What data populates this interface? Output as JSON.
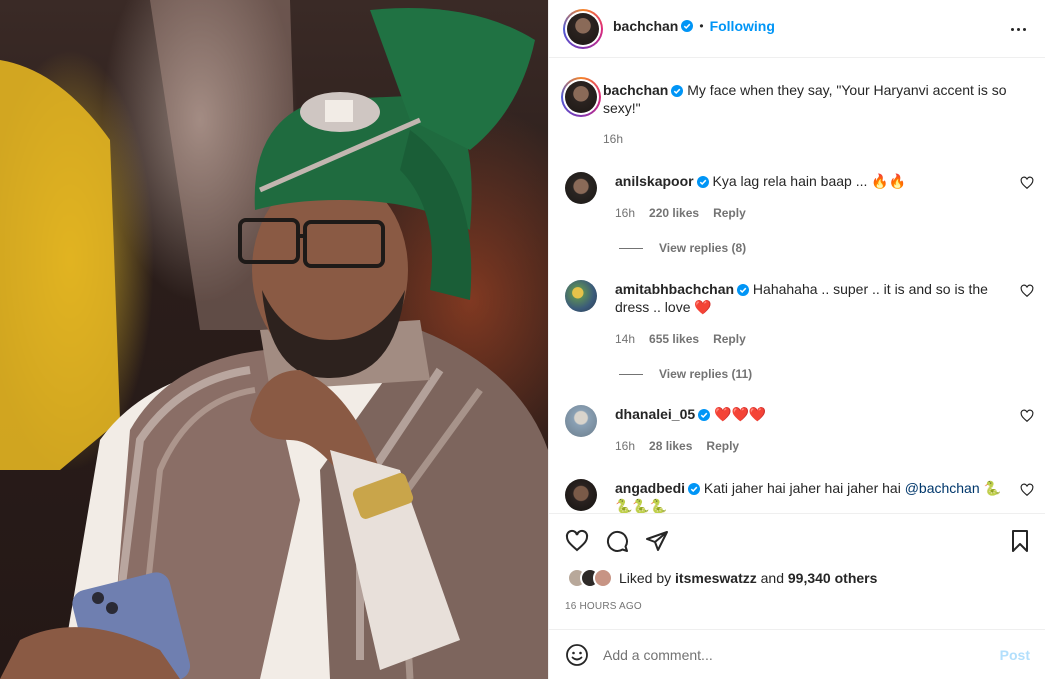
{
  "post": {
    "author": "bachchan",
    "follow_status": "Following",
    "dot": "•",
    "caption": "My face when they say, \"Your Haryanvi accent is so sexy!\"",
    "caption_time": "16h"
  },
  "comments": [
    {
      "user": "anilskapoor",
      "text": "Kya lag rela hain baap ... 🔥🔥",
      "time": "16h",
      "likes": "220 likes",
      "reply": "Reply",
      "view_replies": "View replies (8)"
    },
    {
      "user": "amitabhbachchan",
      "text": "Hahahaha .. super .. it is and so is the dress .. love ❤️",
      "time": "14h",
      "likes": "655 likes",
      "reply": "Reply",
      "view_replies": "View replies (11)"
    },
    {
      "user": "dhanalei_05",
      "text": "❤️❤️❤️",
      "time": "16h",
      "likes": "28 likes",
      "reply": "Reply"
    },
    {
      "user": "angadbedi",
      "text_before": "Kati jaher hai jaher hai jaher hai ",
      "mention": "@bachchan",
      "text_after": " 🐍 🐍🐍🐍"
    }
  ],
  "likes": {
    "prefix": "Liked by ",
    "user": "itsmeswatzz",
    "middle": " and ",
    "count": "99,340 others"
  },
  "timestamp": "16 HOURS AGO",
  "add_comment": {
    "placeholder": "Add a comment...",
    "post_label": "Post"
  },
  "colors": {
    "accent": "#0095f6",
    "post_disabled": "#b2dffc",
    "heart": "#ed4956"
  }
}
